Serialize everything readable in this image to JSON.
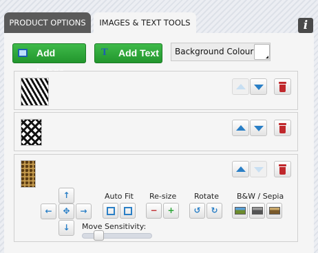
{
  "tabs": [
    {
      "label": "PRODUCT OPTIONS",
      "active": false
    },
    {
      "label": "IMAGES & TEXT TOOLS",
      "active": true
    }
  ],
  "info": {
    "label": "i"
  },
  "toolbar": {
    "add_image_label": "Add Image",
    "add_text_label": "Add Text",
    "background_colour_label": "Background Colour",
    "background_colour_value": "#ffffff"
  },
  "layers": [
    {
      "pattern": "zebra",
      "up_enabled": false,
      "down_enabled": true
    },
    {
      "pattern": "geometric",
      "up_enabled": true,
      "down_enabled": true
    },
    {
      "pattern": "leopard",
      "up_enabled": true,
      "down_enabled": false
    }
  ],
  "tools": {
    "auto_fit_label": "Auto Fit",
    "resize_label": "Re-size",
    "rotate_label": "Rotate",
    "bw_sepia_label": "B&W / Sepia",
    "move_sensitivity_label": "Move Sensitivity:",
    "move_sensitivity_value": 0.2
  },
  "colors": {
    "accent_green": "#2aa535",
    "arrow_blue": "#2a7fc6",
    "delete_red": "#c0282c",
    "tab_inactive": "#5a5a5a"
  }
}
